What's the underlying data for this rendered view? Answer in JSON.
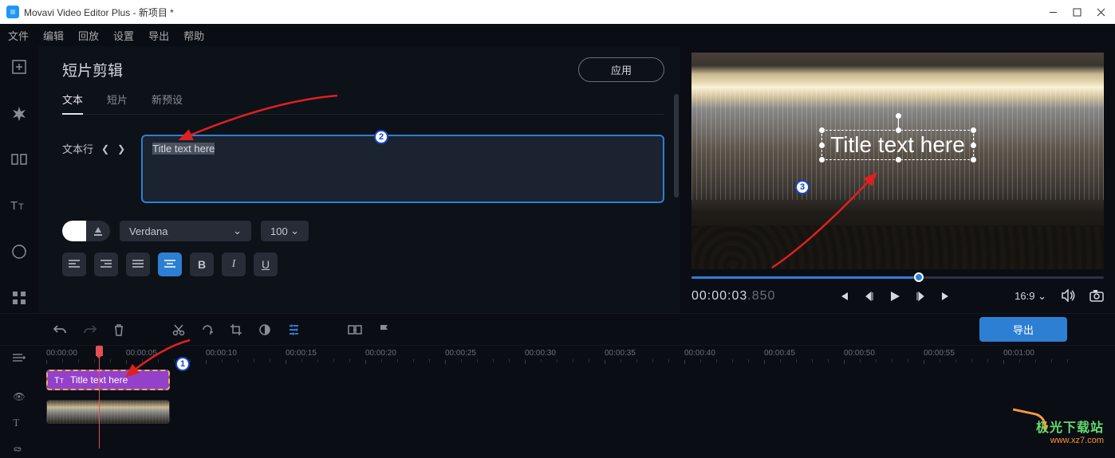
{
  "window": {
    "title": "Movavi Video Editor Plus - 新项目 *"
  },
  "menu": {
    "file": "文件",
    "edit": "编辑",
    "playback": "回放",
    "settings": "设置",
    "export": "导出",
    "help": "帮助"
  },
  "panel": {
    "title": "短片剪辑",
    "apply": "应用",
    "tab_text": "文本",
    "tab_clip": "短片",
    "tab_preset": "新预设",
    "text_line": "文本行",
    "text_value": "Title text here",
    "font": "Verdana",
    "font_size": "100"
  },
  "preview": {
    "overlay_text": "Title text here",
    "time_main": "00:00:03",
    "time_ms": ".850",
    "aspect": "16:9"
  },
  "toolbar": {
    "export": "导出"
  },
  "timeline": {
    "marks": [
      "00:00:00",
      "00:00:05",
      "00:00:10",
      "00:00:15",
      "00:00:20",
      "00:00:25",
      "00:00:30",
      "00:00:35",
      "00:00:40",
      "00:00:45",
      "00:00:50",
      "00:00:55",
      "00:01:00"
    ],
    "title_clip": "Title text here"
  },
  "callouts": {
    "c1": "1",
    "c2": "2",
    "c3": "3"
  },
  "watermark": {
    "top": "极光下载站",
    "bot": "www.xz7.com"
  }
}
